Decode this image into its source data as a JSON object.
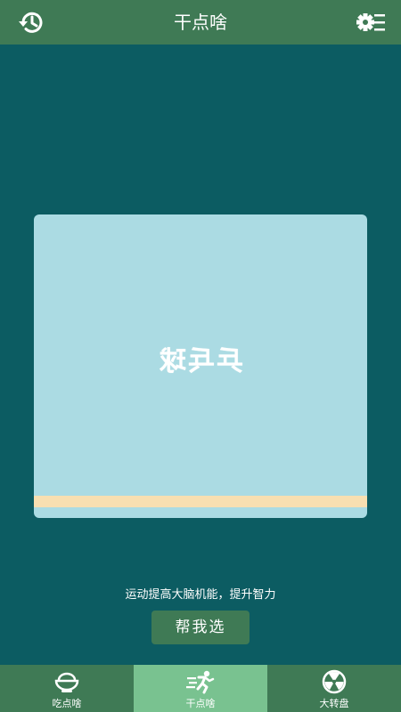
{
  "header": {
    "title": "干点啥",
    "history_icon": "history-icon",
    "settings_icon": "settings-menu-icon"
  },
  "card": {
    "text": "乒乓球",
    "text_mirrored": true,
    "background_color": "#abdbe3",
    "strip_color": "#f8dfb1"
  },
  "description": "运动提高大脑机能，提升智力",
  "pick_button": {
    "label": "帮我选"
  },
  "bottom_nav": {
    "items": [
      {
        "label": "吃点啥",
        "icon": "food-bowl-icon",
        "active": false
      },
      {
        "label": "干点啥",
        "icon": "running-person-icon",
        "active": true
      },
      {
        "label": "大转盘",
        "icon": "wheel-icon",
        "active": false
      }
    ]
  },
  "colors": {
    "background": "#0c5c62",
    "bar": "#3f7a55",
    "nav_active": "#79c290"
  }
}
